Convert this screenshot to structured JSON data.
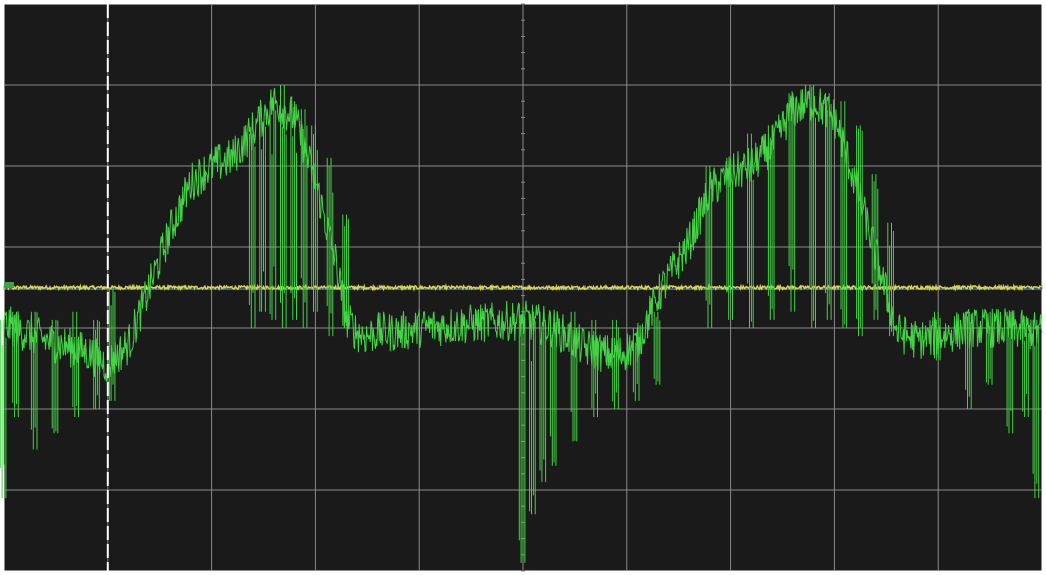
{
  "chart_data": {
    "type": "line",
    "title": "",
    "xlabel": "",
    "ylabel": "",
    "grid": true,
    "divisions": {
      "x": 10,
      "y": 7
    },
    "xlim": [
      0,
      10
    ],
    "ylim": [
      -3.5,
      3.5
    ],
    "series": [
      {
        "color": "#44d344",
        "x": [
          0.0,
          0.4,
          0.8,
          1.0,
          1.2,
          1.4,
          1.6,
          1.8,
          2.0,
          2.2,
          2.4,
          2.6,
          2.8,
          3.0,
          3.2,
          3.3,
          3.4,
          3.5,
          3.6,
          3.8,
          4.0,
          4.5,
          5.0,
          5.3,
          5.6,
          5.9,
          6.1,
          6.3,
          6.6,
          6.8,
          7.0,
          7.2,
          7.4,
          7.6,
          7.8,
          8.0,
          8.2,
          8.4,
          8.6,
          8.8,
          9.0,
          9.3,
          9.6,
          10.0
        ],
        "values": [
          -0.45,
          -0.65,
          -0.8,
          -0.95,
          -0.7,
          0.0,
          0.7,
          1.3,
          1.5,
          1.6,
          1.95,
          2.3,
          2.1,
          1.3,
          0.3,
          -0.4,
          -0.55,
          -0.6,
          -0.55,
          -0.55,
          -0.5,
          -0.45,
          -0.4,
          -0.5,
          -0.75,
          -0.85,
          -0.7,
          -0.1,
          0.55,
          1.2,
          1.4,
          1.5,
          1.75,
          2.2,
          2.3,
          2.1,
          1.3,
          0.4,
          -0.55,
          -0.65,
          -0.6,
          -0.5,
          -0.5,
          -0.55
        ],
        "noise_amplitude": 0.25,
        "spikes": [
          {
            "x": 0.0,
            "low": -2.6,
            "high": -0.4
          },
          {
            "x": 0.12,
            "low": -1.6,
            "high": -0.3
          },
          {
            "x": 0.3,
            "low": -2.0,
            "high": -0.3
          },
          {
            "x": 0.5,
            "low": -1.8,
            "high": -0.4
          },
          {
            "x": 0.7,
            "low": -1.6,
            "high": -0.3
          },
          {
            "x": 0.9,
            "low": -1.5,
            "high": -0.4
          },
          {
            "x": 1.05,
            "low": -1.4,
            "high": 0.0
          },
          {
            "x": 2.4,
            "low": -0.5,
            "high": 1.9
          },
          {
            "x": 2.5,
            "low": -0.3,
            "high": 2.0
          },
          {
            "x": 2.6,
            "low": -0.4,
            "high": 2.3
          },
          {
            "x": 2.7,
            "low": -0.5,
            "high": 2.5
          },
          {
            "x": 2.8,
            "low": -0.4,
            "high": 2.3
          },
          {
            "x": 2.9,
            "low": -0.5,
            "high": 2.2
          },
          {
            "x": 3.0,
            "low": -0.3,
            "high": 2.0
          },
          {
            "x": 3.15,
            "low": -0.6,
            "high": 1.6
          },
          {
            "x": 3.3,
            "low": -0.5,
            "high": 0.9
          },
          {
            "x": 5.0,
            "low": -3.4,
            "high": -0.2
          },
          {
            "x": 5.1,
            "low": -2.8,
            "high": -0.3
          },
          {
            "x": 5.2,
            "low": -2.4,
            "high": -0.3
          },
          {
            "x": 5.3,
            "low": -2.2,
            "high": -0.3
          },
          {
            "x": 5.5,
            "low": -1.9,
            "high": -0.3
          },
          {
            "x": 5.7,
            "low": -1.6,
            "high": -0.4
          },
          {
            "x": 5.9,
            "low": -1.5,
            "high": -0.4
          },
          {
            "x": 6.1,
            "low": -1.4,
            "high": -0.5
          },
          {
            "x": 6.3,
            "low": -1.2,
            "high": -0.3
          },
          {
            "x": 6.8,
            "low": -0.5,
            "high": 1.5
          },
          {
            "x": 7.0,
            "low": -0.4,
            "high": 1.6
          },
          {
            "x": 7.2,
            "low": -0.5,
            "high": 1.9
          },
          {
            "x": 7.4,
            "low": -0.4,
            "high": 2.0
          },
          {
            "x": 7.6,
            "low": -0.3,
            "high": 2.4
          },
          {
            "x": 7.8,
            "low": -0.5,
            "high": 2.5
          },
          {
            "x": 7.95,
            "low": -0.4,
            "high": 2.4
          },
          {
            "x": 8.1,
            "low": -0.5,
            "high": 2.3
          },
          {
            "x": 8.25,
            "low": -0.6,
            "high": 2.0
          },
          {
            "x": 8.4,
            "low": -0.4,
            "high": 1.4
          },
          {
            "x": 8.55,
            "low": -0.6,
            "high": 0.8
          },
          {
            "x": 9.0,
            "low": -0.9,
            "high": -0.3
          },
          {
            "x": 9.3,
            "low": -1.5,
            "high": -0.3
          },
          {
            "x": 9.5,
            "low": -1.2,
            "high": -0.3
          },
          {
            "x": 9.7,
            "low": -1.8,
            "high": -0.3
          },
          {
            "x": 9.85,
            "low": -1.6,
            "high": -0.4
          },
          {
            "x": 9.95,
            "low": -2.6,
            "high": -0.4
          }
        ]
      },
      {
        "color": "#d6d64a",
        "x": [
          0,
          10
        ],
        "values": [
          0.0,
          0.0
        ],
        "noise_amplitude": 0.02
      },
      {
        "color": "#3d6fd1",
        "x": [
          0,
          10
        ],
        "values": [
          -0.02,
          -0.02
        ],
        "noise_amplitude": 0
      }
    ],
    "cursor": {
      "x": 1.0,
      "color": "#ffffff"
    },
    "colors": {
      "background": "#1a1a1a",
      "grid": "#8a8a8a",
      "border": "#ffffff",
      "ground_marker": "#3fa047"
    }
  }
}
